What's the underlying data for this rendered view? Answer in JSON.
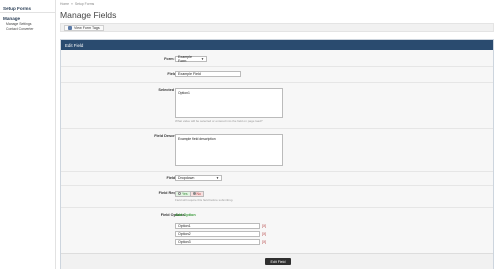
{
  "sidebar": {
    "section1": "Setup Forms",
    "section2": "Manage",
    "links": [
      "Manage Settings",
      "Contact Converter"
    ]
  },
  "breadcrumb": {
    "home": "Home",
    "sep": "»",
    "current": "Setup Forms"
  },
  "page_title": "Manage Fields",
  "toolbar": {
    "button_label": "View Form Tags"
  },
  "panel": {
    "title": "Edit Field"
  },
  "form": {
    "form_name": {
      "label": "Form Name",
      "value": "Example Form"
    },
    "field_title": {
      "label": "Field Title",
      "value": "Example Field"
    },
    "selected_value": {
      "label": "Selected Value",
      "value": "Option1",
      "help": "What value will be selected or entered into the field on page load?"
    },
    "field_description": {
      "label": "Field Description",
      "value": "Example field description"
    },
    "field_type": {
      "label": "Field Type",
      "value": "Dropdown"
    },
    "field_required": {
      "label": "Field Required",
      "yes": "Yes",
      "no": "No",
      "selected": "No",
      "help": "Field will require this field before submitting."
    },
    "field_options": {
      "label": "Field Options",
      "add_label": "Add Option",
      "options": [
        "Option1",
        "Option2",
        "Option3"
      ],
      "delete_label": "[X]"
    }
  },
  "submit_label": "Edit Field",
  "colors": {
    "header_bar": "#2a4b6f",
    "add_option": "#3a9a3a",
    "delete": "#b03838",
    "submit": "#2f2f2f"
  }
}
